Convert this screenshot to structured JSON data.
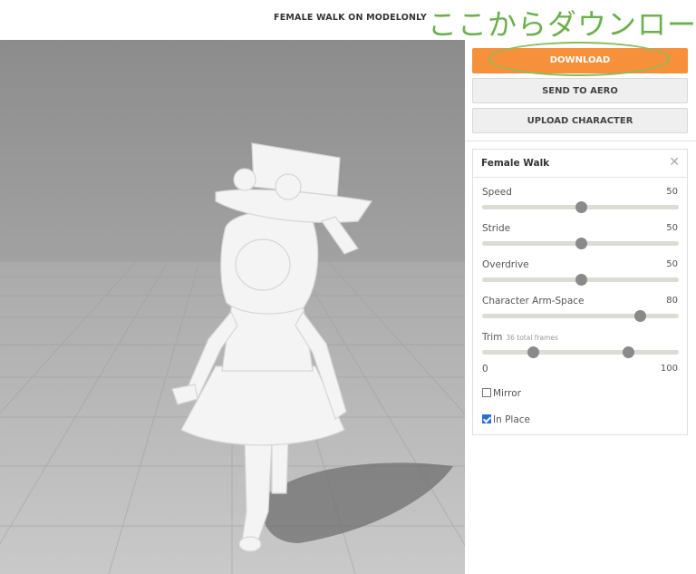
{
  "header": {
    "title": "FEMALE WALK ON MODELONLY",
    "annotation": "ここからダウンロード"
  },
  "buttons": {
    "download": "DOWNLOAD",
    "send_to_aero": "SEND TO AERO",
    "upload_character": "UPLOAD CHARACTER"
  },
  "panel": {
    "title": "Female Walk",
    "close_icon": "close-icon",
    "sliders": [
      {
        "label": "Speed",
        "value": "50",
        "fraction": 0.5
      },
      {
        "label": "Stride",
        "value": "50",
        "fraction": 0.5
      },
      {
        "label": "Overdrive",
        "value": "50",
        "fraction": 0.5
      },
      {
        "label": "Character Arm-Space",
        "value": "80",
        "fraction": 0.8
      }
    ],
    "trim": {
      "label": "Trim",
      "sub": "36 total frames",
      "min_label": "0",
      "max_label": "100",
      "range": [
        0.26,
        0.74
      ]
    },
    "checkboxes": [
      {
        "label": "Mirror",
        "checked": false
      },
      {
        "label": "In Place",
        "checked": true
      }
    ]
  },
  "colors": {
    "accent": "#f7903a",
    "annotation": "#6ab04c",
    "checkbox": "#2a6fd6"
  }
}
